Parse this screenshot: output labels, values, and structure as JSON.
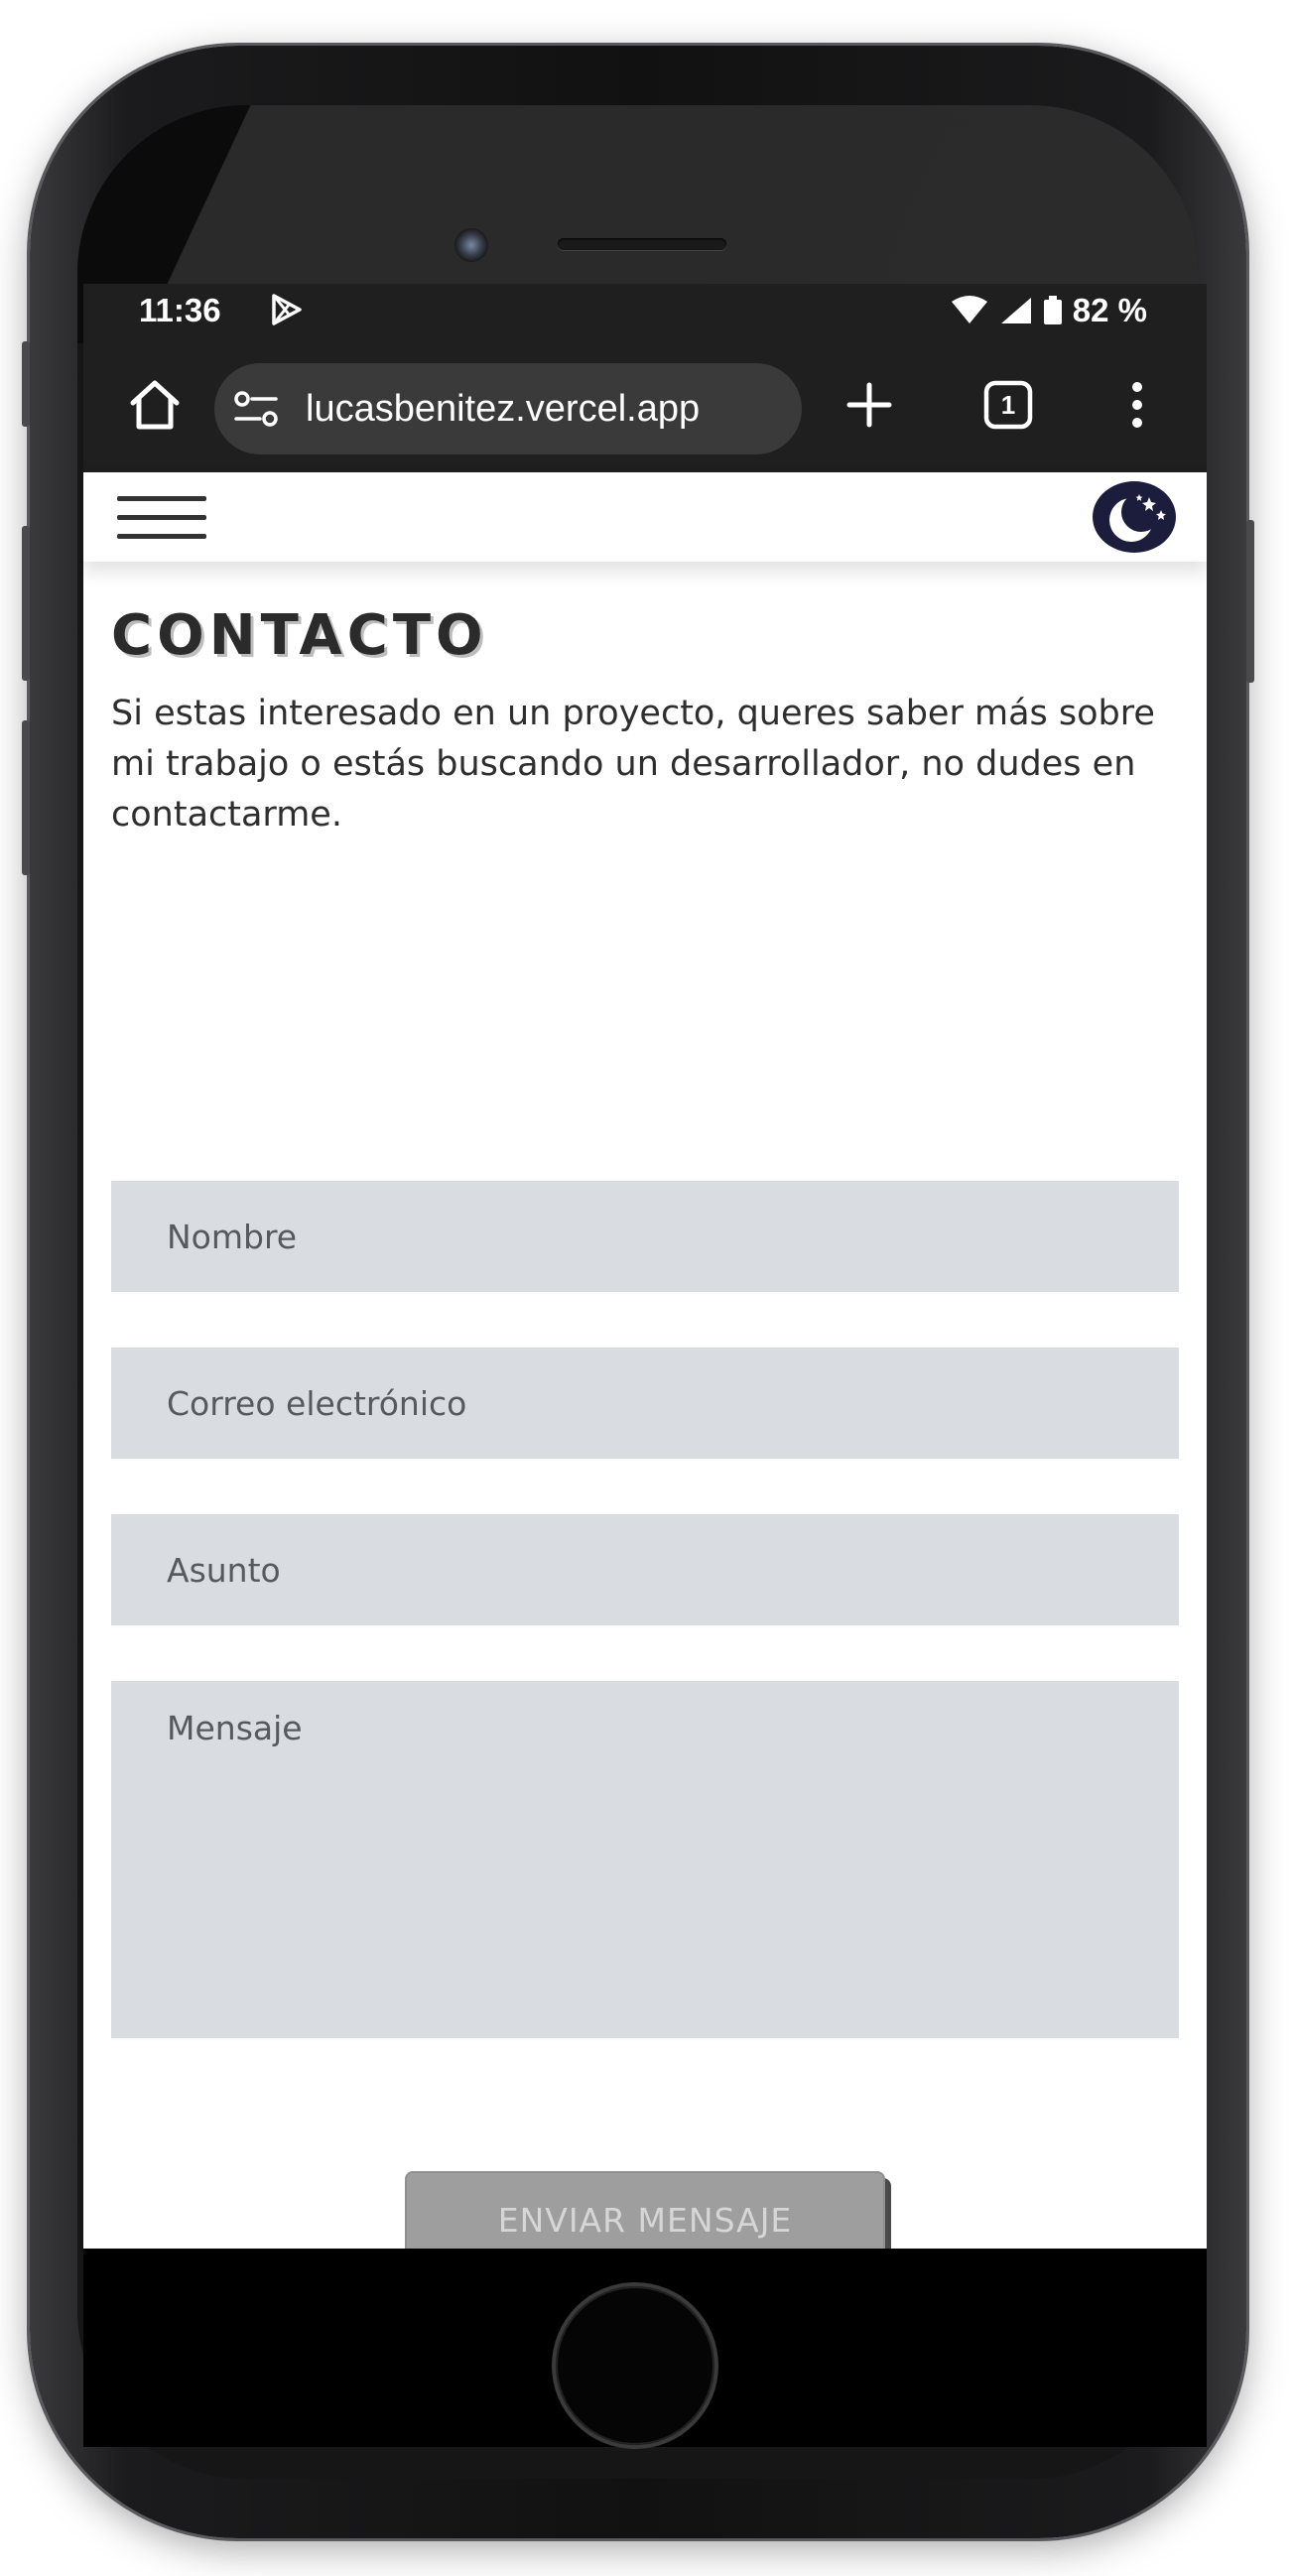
{
  "status_bar": {
    "time": "11:36",
    "battery": "82 %"
  },
  "browser": {
    "url": "lucasbenitez.vercel.app",
    "tab_count": "1"
  },
  "page": {
    "title": "CONTACTO",
    "intro": "Si estas interesado en un proyecto, queres saber más sobre mi trabajo o estás buscando un desarrollador, no dudes en contactarme."
  },
  "form": {
    "name_placeholder": "Nombre",
    "email_placeholder": "Correo electrónico",
    "subject_placeholder": "Asunto",
    "message_placeholder": "Mensaje",
    "submit_label": "ENVIAR MENSAJE"
  },
  "colors": {
    "field_bg": "#d9dce0",
    "button_bg": "#9e9e9e",
    "theme_toggle_bg": "#1c1c3c",
    "browser_bar_bg": "#1f1f1f"
  }
}
